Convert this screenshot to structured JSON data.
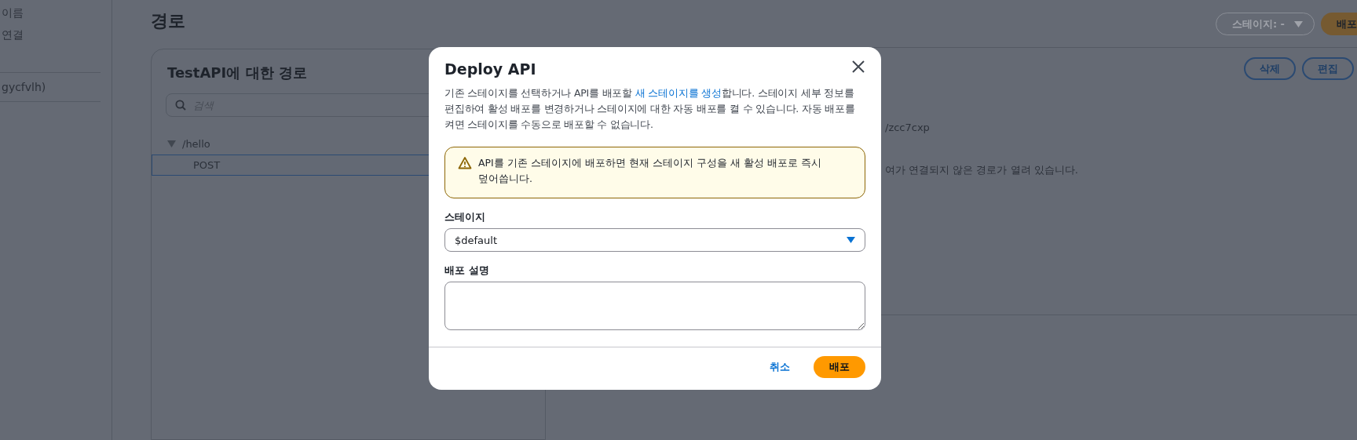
{
  "sidebar": {
    "items": [
      "이름",
      "연결"
    ],
    "api_label": "gycfvlh)"
  },
  "header": {
    "title": "경로",
    "stage_selector": "스테이지: -",
    "deploy_button": "배포"
  },
  "routes_panel": {
    "title": "TestAPI에 대한 경로",
    "search": {
      "placeholder": "검색"
    },
    "tree": [
      {
        "label": "/hello",
        "expanded": true,
        "selected": false,
        "children": [
          {
            "label": "POST",
            "selected": true
          }
        ]
      }
    ]
  },
  "detail_panel": {
    "buttons": [
      "삭제",
      "편집"
    ],
    "lines": [
      "/zcc7cxp",
      "여가 연결되지 않은 경로가 열려 있습니다."
    ]
  },
  "dialog": {
    "title": "Deploy API",
    "description_before": "기존 스테이지를 선택하거나 API를 배포할 ",
    "description_link": "새 스테이지를 생성",
    "description_after": "합니다. 스테이지 세부 정보를 편집하여 활성 배포를 변경하거나 스테이지에 대한 자동 배포를 켤 수 있습니다. 자동 배포를 켜면 스테이지를 수동으로 배포할 수 없습니다.",
    "warning": "API를 기존 스테이지에 배포하면 현재 스테이지 구성을 새 활성 배포로 즉시 덮어씁니다.",
    "stage_label": "스테이지",
    "stage_value": "$default",
    "description_label": "배포 설명",
    "cancel_button": "취소",
    "deploy_button": "배포"
  }
}
